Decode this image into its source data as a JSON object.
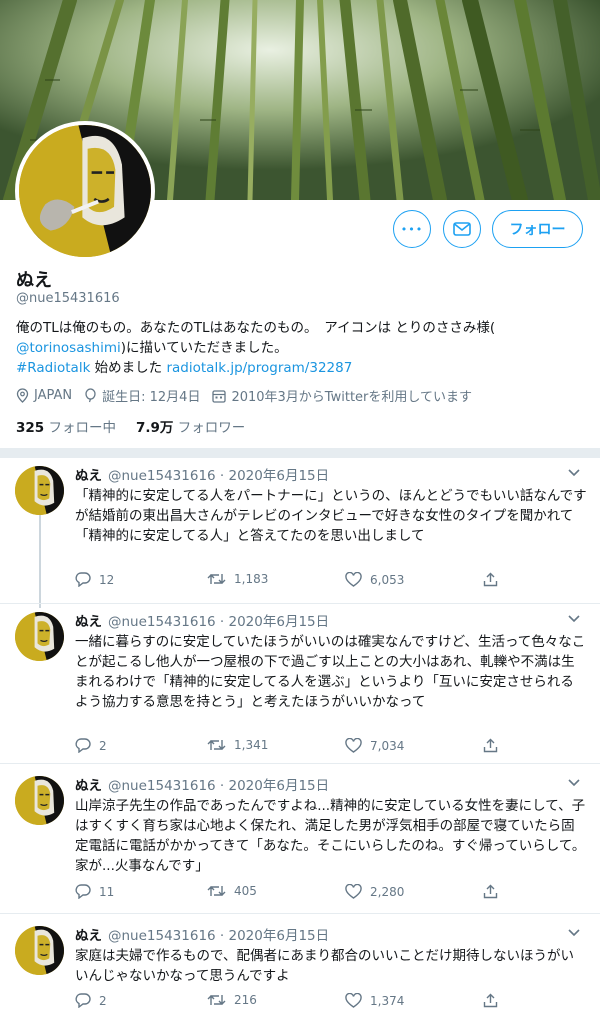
{
  "profile": {
    "name": "ぬえ",
    "handle": "@nue15431616",
    "bio_line1": "俺のTLは俺のもの。あなたのTLはあなたのもの。　アイコンは とりのささみ様(",
    "bio_mention": "@torinosashimi",
    "bio_line2_rest": ")に描いていただきました。",
    "bio_hashtag": "#Radiotalk",
    "bio_line3_mid": " 始めました ",
    "bio_link": "radiotalk.jp/program/32287",
    "location": "JAPAN",
    "birthday": "誕生日: 12月4日",
    "joined": "2010年3月からTwitterを利用しています",
    "following_count": "325",
    "following_label": "フォロー中",
    "followers_count": "7.9万",
    "followers_label": "フォロワー",
    "follow_button": "フォロー",
    "more_icon_text": "•••"
  },
  "colors": {
    "accent": "#1da1f2",
    "link": "#1b95e0",
    "muted": "#657786",
    "divider": "#e6ecf0"
  },
  "tweets": [
    {
      "name": "ぬえ",
      "meta": "@nue15431616 · 2020年6月15日",
      "text": "「精神的に安定してる人をパートナーに」というの、ほんとどうでもいい話なんですが結婚前の東出昌大さんがテレビのインタビューで好きな女性のタイプを聞かれて「精神的に安定してる人」と答えてたのを思い出しまして",
      "replies": "12",
      "retweets": "1,183",
      "likes": "6,053"
    },
    {
      "name": "ぬえ",
      "meta": "@nue15431616 · 2020年6月15日",
      "text": "一緒に暮らすのに安定していたほうがいいのは確実なんですけど、生活って色々なことが起こるし他人が一つ屋根の下で過ごす以上ことの大小はあれ、軋轢や不満は生まれるわけで「精神的に安定してる人を選ぶ」というより「互いに安定させられるよう協力する意思を持とう」と考えたほうがいいかなって",
      "replies": "2",
      "retweets": "1,341",
      "likes": "7,034"
    },
    {
      "name": "ぬえ",
      "meta": "@nue15431616 · 2020年6月15日",
      "text": "山岸涼子先生の作品であったんですよね...精神的に安定している女性を妻にして、子はすくすく育ち家は心地よく保たれ、満足した男が浮気相手の部屋で寝ていたら固定電話に電話がかかってきて「あなた。そこにいらしたのね。すぐ帰っていらして。家が...火事なんです」",
      "replies": "11",
      "retweets": "405",
      "likes": "2,280"
    },
    {
      "name": "ぬえ",
      "meta": "@nue15431616 · 2020年6月15日",
      "text": "家庭は夫婦で作るもので、配偶者にあまり都合のいいことだけ期待しないほうがいいんじゃないかなって思うんですよ",
      "replies": "2",
      "retweets": "216",
      "likes": "1,374"
    }
  ]
}
